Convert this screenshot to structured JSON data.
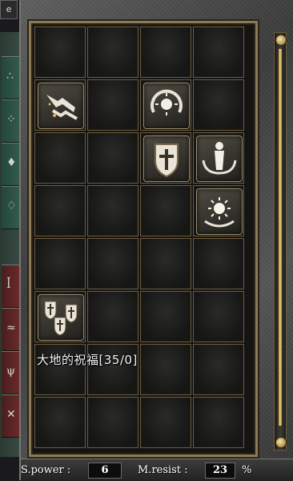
{
  "header": {
    "tab_label": "e"
  },
  "grid": {
    "items": [
      {
        "row": 1,
        "col": 0,
        "icon": "wings-buff-icon",
        "name": "wings-buff"
      },
      {
        "row": 1,
        "col": 2,
        "icon": "sun-shield-icon",
        "name": "sun-crescent"
      },
      {
        "row": 2,
        "col": 2,
        "icon": "cross-shield-icon",
        "name": "cross-shield"
      },
      {
        "row": 2,
        "col": 3,
        "icon": "guardian-figure-icon",
        "name": "guardian"
      },
      {
        "row": 3,
        "col": 3,
        "icon": "radiant-sun-icon",
        "name": "radiant-sun"
      },
      {
        "row": 5,
        "col": 0,
        "icon": "triple-shield-icon",
        "name": "triple-shield"
      }
    ]
  },
  "tooltip": {
    "text": "大地的祝福[35/0]"
  },
  "stats": {
    "spower_label": "S.power :",
    "spower_value": "6",
    "mresist_label": "M.resist :",
    "mresist_value": "23",
    "percent": "%"
  },
  "colors": {
    "frame": "#8a7a55",
    "rail": "#f1d37d"
  }
}
